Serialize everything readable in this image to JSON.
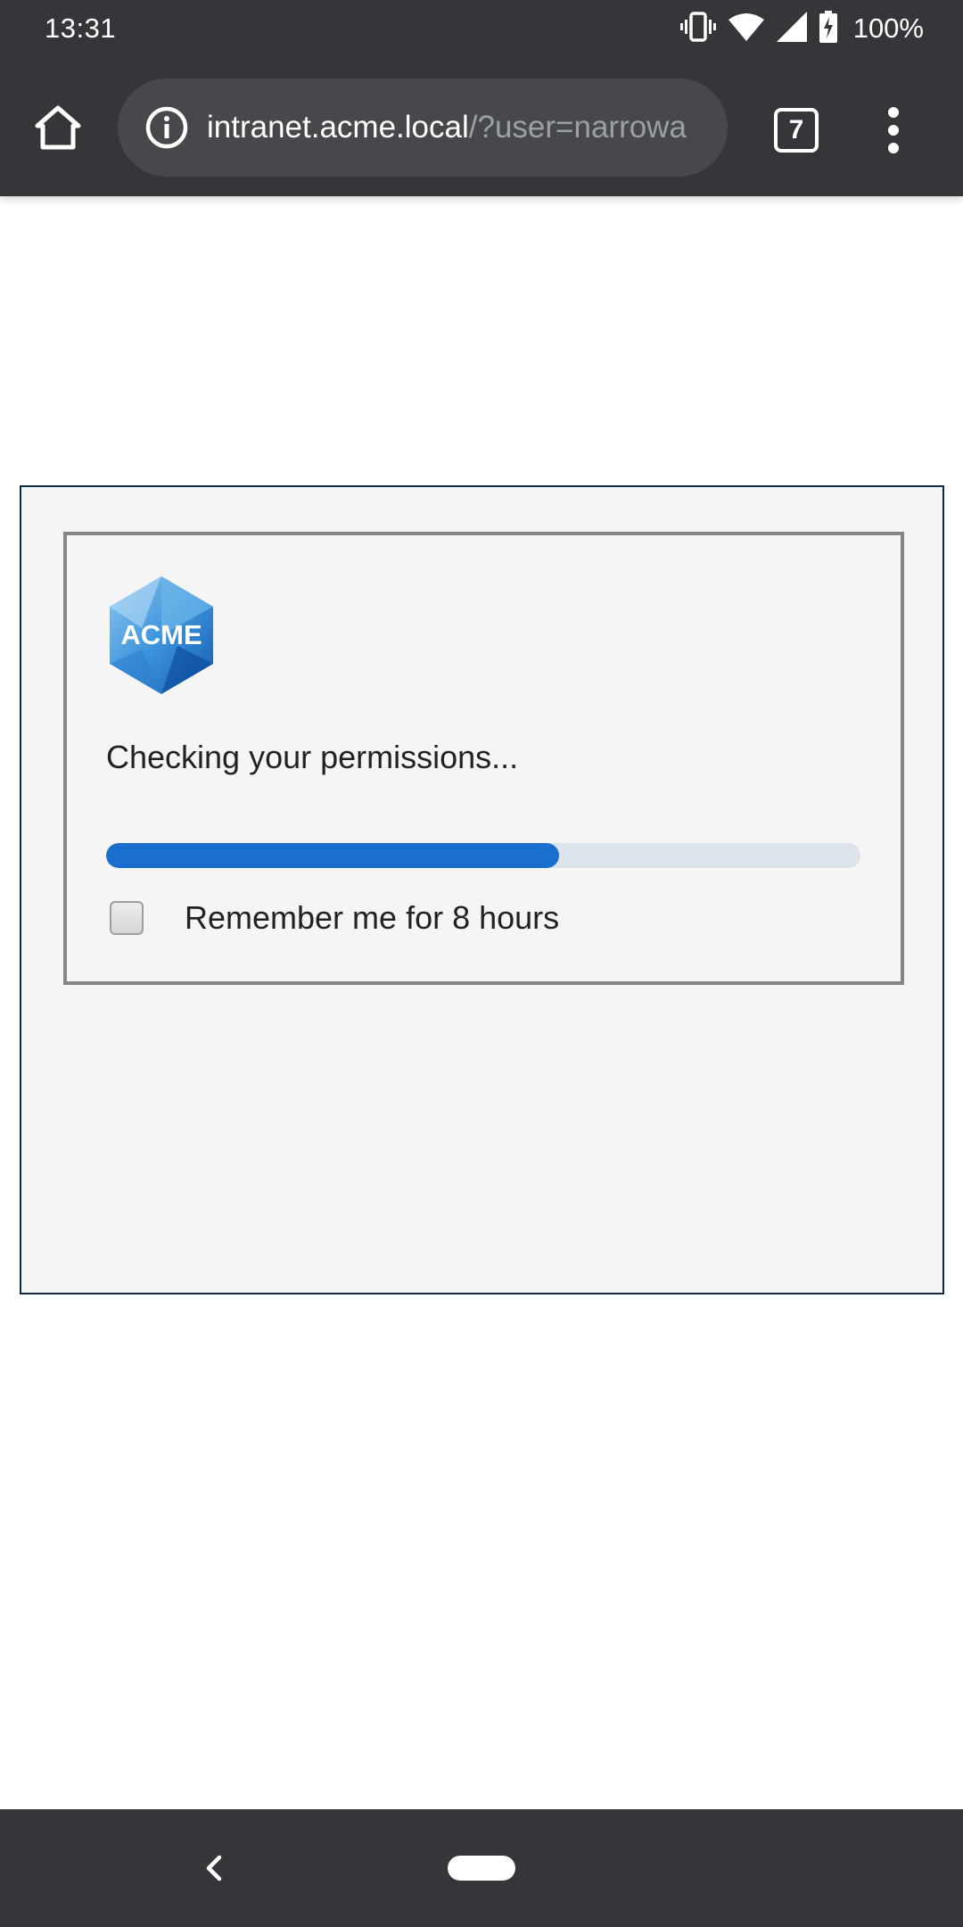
{
  "status_bar": {
    "time": "13:31",
    "battery": "100%",
    "icons": [
      "vibrate-icon",
      "wifi-icon",
      "cell-signal-icon",
      "battery-charging-icon"
    ]
  },
  "browser": {
    "url_host": "intranet.acme.local",
    "url_path": "/?user=narrowa",
    "tab_count": "7",
    "icons": [
      "home-icon",
      "info-icon",
      "overflow-menu-icon"
    ]
  },
  "page": {
    "logo_text": "ACME",
    "status_message": "Checking your permissions...",
    "progress": 0.6,
    "remember_label": "Remember me for 8 hours",
    "remember_checked": false
  },
  "colors": {
    "chrome": "#35363a",
    "accent": "#1a6fce",
    "track": "#dde3ea",
    "panel_bg": "#f5f5f5"
  },
  "nav": {
    "icons": [
      "back-icon",
      "home-pill-icon"
    ]
  }
}
